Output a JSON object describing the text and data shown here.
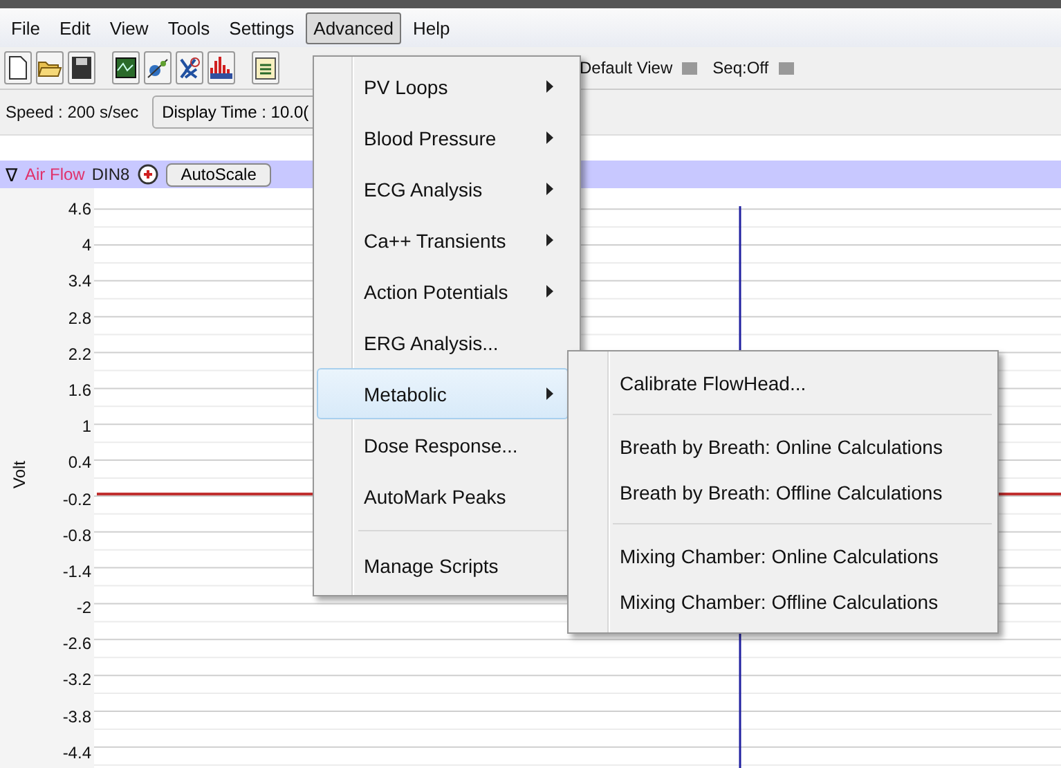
{
  "menu_bar": [
    {
      "label": "File",
      "selected": false
    },
    {
      "label": "Edit",
      "selected": false
    },
    {
      "label": "View",
      "selected": false
    },
    {
      "label": "Tools",
      "selected": false
    },
    {
      "label": "Settings",
      "selected": false
    },
    {
      "label": "Advanced",
      "selected": true
    },
    {
      "label": "Help",
      "selected": false
    }
  ],
  "toolbar": {
    "view": "Default View",
    "sequence": "Seq:Off"
  },
  "speed": "Speed : 200 s/sec",
  "display_time": "Display Time : 10.0(",
  "channel": {
    "collapse": "∇",
    "name": "Air Flow",
    "input": "DIN8",
    "autoscale": "AutoScale"
  },
  "chart": {
    "ylabel": "Volt",
    "yticks": [
      "4.6",
      "4",
      "3.4",
      "2.8",
      "2.2",
      "1.6",
      "1",
      "0.4",
      "-0.2",
      "-0.8",
      "-1.4",
      "-2",
      "-2.6",
      "-3.2",
      "-3.8",
      "-4.4"
    ]
  },
  "menu": {
    "items": [
      {
        "kind": "item",
        "label": "PV Loops",
        "submenu": true,
        "selected": false
      },
      {
        "kind": "item",
        "label": "Blood Pressure",
        "submenu": true,
        "selected": false
      },
      {
        "kind": "item",
        "label": "ECG Analysis",
        "submenu": true,
        "selected": false
      },
      {
        "kind": "item",
        "label": "Ca++ Transients",
        "submenu": true,
        "selected": false
      },
      {
        "kind": "item",
        "label": "Action Potentials",
        "submenu": true,
        "selected": false
      },
      {
        "kind": "item",
        "label": "ERG Analysis...",
        "submenu": false,
        "selected": false
      },
      {
        "kind": "item",
        "label": "Metabolic",
        "submenu": true,
        "selected": true
      },
      {
        "kind": "item",
        "label": "Dose Response...",
        "submenu": false,
        "selected": false
      },
      {
        "kind": "item",
        "label": "AutoMark Peaks",
        "submenu": false,
        "selected": false
      },
      {
        "kind": "separator"
      },
      {
        "kind": "item",
        "label": "Manage Scripts",
        "submenu": false,
        "selected": false
      }
    ]
  },
  "submenu": {
    "items": [
      {
        "kind": "item",
        "label": "Calibrate FlowHead..."
      },
      {
        "kind": "separator"
      },
      {
        "kind": "item",
        "label": "Breath by Breath: Online Calculations"
      },
      {
        "kind": "item",
        "label": "Breath by Breath: Offline Calculations"
      },
      {
        "kind": "separator"
      },
      {
        "kind": "item",
        "label": "Mixing Chamber: Online Calculations"
      },
      {
        "kind": "item",
        "label": "Mixing Chamber: Offline Calculations"
      }
    ]
  }
}
